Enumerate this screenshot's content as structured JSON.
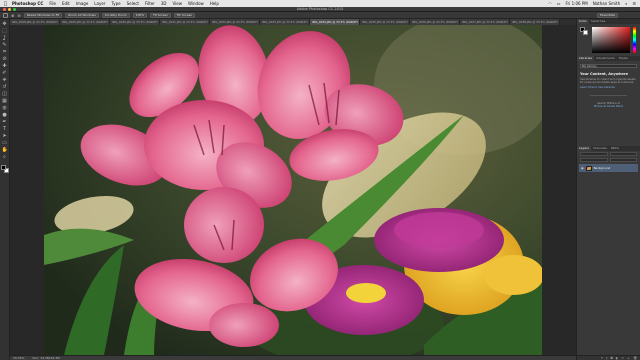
{
  "menubar": {
    "apple": "",
    "app": "Photoshop CC",
    "items": [
      "File",
      "Edit",
      "Image",
      "Layer",
      "Type",
      "Select",
      "Filter",
      "3D",
      "View",
      "Window",
      "Help"
    ],
    "time": "Fri 1:06 PM",
    "user": "Nathan Smith"
  },
  "window": {
    "title": "Adobe Photoshop CC 2015",
    "traffic_colors": [
      "#fc605c",
      "#fdbc40",
      "#34c84a"
    ]
  },
  "options": {
    "chips": [
      "Resize Windows to Fit",
      "Zoom All Windows",
      "Scrubby Zoom",
      "100%",
      "Fit Screen",
      "Fill Screen"
    ],
    "workspace": "Essentials"
  },
  "tabs": [
    "IMG_0028.JPG @ 33.3% (RGB/8*)",
    "IMG_0029.JPG @ 33.3% (RGB/8*)",
    "IMG_0030.JPG @ 33.3% (RGB/8*)",
    "IMG_0031.JPG @ 33.3% (RGB/8*)",
    "IMG_0032.JPG @ 33.3% (RGB/8*)",
    "IMG_0033.JPG @ 33.3% (RGB/8*)",
    "IMG_0034.JPG @ 33.3% (RGB/8*)",
    "IMG_0035.JPG @ 33.3% (RGB/8*)",
    "IMG_0036.JPG @ 33.3% (RGB/8*)",
    "IMG_0037.JPG @ 33.3% (RGB/8*)",
    "IMG_0038.JPG @ 33.3% (RGB/8*)"
  ],
  "active_tab": 6,
  "toolbar": {
    "icons": [
      "move-icon",
      "marquee-icon",
      "lasso-icon",
      "quick-select-icon",
      "crop-icon",
      "eyedropper-icon",
      "healing-icon",
      "brush-icon",
      "clone-icon",
      "history-brush-icon",
      "eraser-icon",
      "gradient-icon",
      "blur-icon",
      "dodge-icon",
      "pen-icon",
      "type-icon",
      "path-select-icon",
      "shape-icon",
      "hand-icon",
      "zoom-icon"
    ],
    "glyphs": [
      "✥",
      "⬚",
      "ʆ",
      "✎",
      "⌗",
      "⊘",
      "✚",
      "✐",
      "⎈",
      "↺",
      "◫",
      "▦",
      "◍",
      "●",
      "✒",
      "T",
      "➤",
      "▭",
      "✋",
      "⌕"
    ],
    "foreground_color": "#000000",
    "background_color": "#ffffff"
  },
  "status": {
    "zoom": "33.33%",
    "doc": "Doc: 34.3M/34.3M"
  },
  "panels": {
    "color_tabs": [
      "Color",
      "Swatches"
    ],
    "library_tabs": [
      "Libraries",
      "Adjustments",
      "Styles"
    ],
    "library_dropdown": "My Library",
    "library_heading": "Your Content, Anywhere",
    "library_text": "Use libraries to collect and organize assets for reuse across Adobe apps and devices.",
    "library_link": "Learn How to Use Libraries",
    "stock_text": "Search Millions of",
    "stock_link": "Photos at Adobe Stock",
    "layers_tabs": [
      "Layers",
      "Channels",
      "Paths"
    ],
    "layer_name": "Background"
  }
}
